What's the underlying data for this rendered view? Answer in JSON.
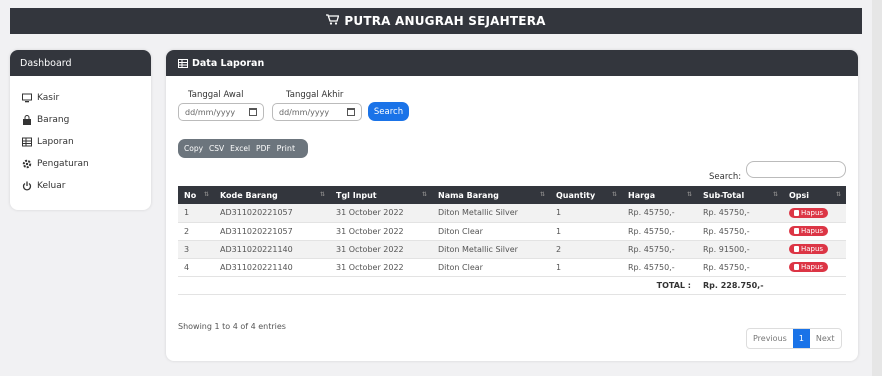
{
  "header": {
    "title": "PUTRA ANUGRAH SEJAHTERA",
    "icon": "cart-icon"
  },
  "sidebar": {
    "title": "Dashboard",
    "items": [
      {
        "label": "Kasir",
        "icon": "monitor-icon"
      },
      {
        "label": "Barang",
        "icon": "bag-icon"
      },
      {
        "label": "Laporan",
        "icon": "table-icon"
      },
      {
        "label": "Pengaturan",
        "icon": "gear-icon"
      },
      {
        "label": "Keluar",
        "icon": "power-icon"
      }
    ]
  },
  "panel": {
    "title": "Data Laporan"
  },
  "filters": {
    "start_label": "Tanggal Awal",
    "end_label": "Tanggal Akhir",
    "start_placeholder": "dd/mm/yyyy",
    "end_placeholder": "dd/mm/yyyy",
    "search_button": "Search"
  },
  "export": {
    "copy": "Copy",
    "csv": "CSV",
    "excel": "Excel",
    "pdf": "PDF",
    "print": "Print"
  },
  "search": {
    "label": "Search:"
  },
  "table": {
    "headers": [
      "No",
      "Kode Barang",
      "Tgl Input",
      "Nama Barang",
      "Quantity",
      "Harga",
      "Sub-Total",
      "Opsi"
    ],
    "rows": [
      [
        "1",
        "AD311020221057",
        "31 October 2022",
        "Diton Metallic Silver",
        "1",
        "Rp. 45750,-",
        "Rp. 45750,-",
        "Hapus"
      ],
      [
        "2",
        "AD311020221057",
        "31 October 2022",
        "Diton Clear",
        "1",
        "Rp. 45750,-",
        "Rp. 45750,-",
        "Hapus"
      ],
      [
        "3",
        "AD311020221140",
        "31 October 2022",
        "Diton Metallic Silver",
        "2",
        "Rp. 45750,-",
        "Rp. 91500,-",
        "Hapus"
      ],
      [
        "4",
        "AD311020221140",
        "31 October 2022",
        "Diton Clear",
        "1",
        "Rp. 45750,-",
        "Rp. 45750,-",
        "Hapus"
      ]
    ],
    "total_label": "TOTAL :",
    "total_value": "Rp. 228.750,-"
  },
  "info": "Showing 1 to 4 of 4 entries",
  "pagination": {
    "previous": "Previous",
    "current": "1",
    "next": "Next"
  },
  "colors": {
    "dark": "#33363d",
    "primary": "#1a73e8",
    "danger": "#dc3545",
    "export": "#6c757d"
  }
}
